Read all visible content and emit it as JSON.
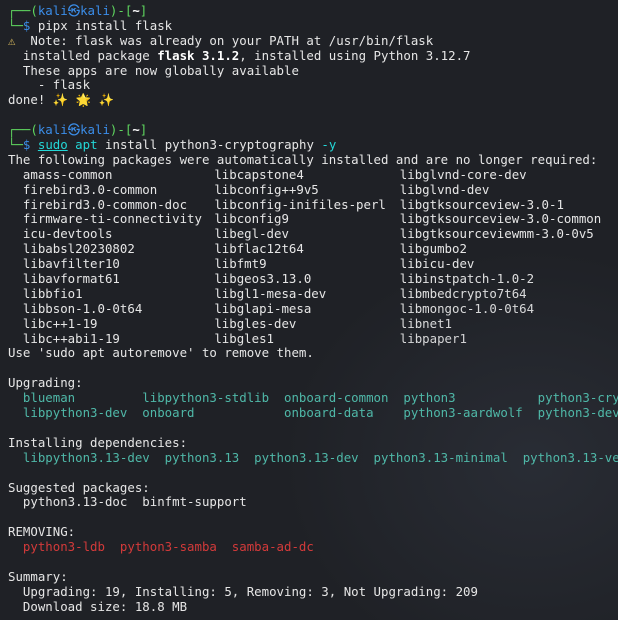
{
  "prompt1": {
    "top": "┌──(",
    "user": "kali",
    "at": "㉿",
    "host": "kali",
    "dir_open": ")-[",
    "dir": "~",
    "dir_close": "]",
    "bottom": "└─",
    "dollar": "$",
    "command": "pipx install flask"
  },
  "pipx_output": {
    "warn_symbol": "⚠",
    "note": "  Note: flask was already on your PATH at /usr/bin/flask",
    "installed_pre": "  installed package ",
    "installed_pkg": "flask 3.1.2",
    "installed_post": ", installed using Python 3.12.7",
    "apps_line": "  These apps are now globally available",
    "app_item": "    - flask",
    "done": "done! ✨ 🌟 ✨"
  },
  "prompt2": {
    "top": "┌──(",
    "user": "kali",
    "at": "㉿",
    "host": "kali",
    "dir_open": ")-[",
    "dir": "~",
    "dir_close": "]",
    "bottom": "└─",
    "dollar": "$",
    "cmd_sudo": "sudo",
    "cmd_apt": "apt",
    "cmd_rest": "install python3-cryptography",
    "cmd_flag": "-y"
  },
  "apt_output": {
    "auto_installed_header": "The following packages were automatically installed and are no longer required:",
    "auto_installed": [
      [
        "  amass-common",
        "libcapstone4",
        "libglvnd-core-dev"
      ],
      [
        "  firebird3.0-common",
        "libconfig++9v5",
        "libglvnd-dev"
      ],
      [
        "  firebird3.0-common-doc",
        "libconfig-inifiles-perl",
        "libgtksourceview-3.0-1"
      ],
      [
        "  firmware-ti-connectivity",
        "libconfig9",
        "libgtksourceview-3.0-common"
      ],
      [
        "  icu-devtools",
        "libegl-dev",
        "libgtksourceviewmm-3.0-0v5"
      ],
      [
        "  libabsl20230802",
        "libflac12t64",
        "libgumbo2"
      ],
      [
        "  libavfilter10",
        "libfmt9",
        "libicu-dev"
      ],
      [
        "  libavformat61",
        "libgeos3.13.0",
        "libinstpatch-1.0-2"
      ],
      [
        "  libbfio1",
        "libgl1-mesa-dev",
        "libmbedcrypto7t64"
      ],
      [
        "  libbson-1.0-0t64",
        "libglapi-mesa",
        "libmongoc-1.0-0t64"
      ],
      [
        "  libc++1-19",
        "libgles-dev",
        "libnet1"
      ],
      [
        "  libc++abi1-19",
        "libgles1",
        "libpaper1"
      ]
    ],
    "autoremove": "Use 'sudo apt autoremove' to remove them.",
    "upgrading_header": "Upgrading:",
    "upgrading_line1": "  blueman         libpython3-stdlib  onboard-common  python3           python3-cry",
    "upgrading_line2": "  libpython3-dev  onboard            onboard-data    python3-aardwolf  python3-dev",
    "deps_header": "Installing dependencies:",
    "deps_line": "  libpython3.13-dev  python3.13  python3.13-dev  python3.13-minimal  python3.13-ve",
    "suggested_header": "Suggested packages:",
    "suggested_line": "  python3.13-doc  binfmt-support",
    "removing_header": "REMOVING:",
    "removing_line": "  python3-ldb  python3-samba  samba-ad-dc",
    "summary_header": "Summary:",
    "summary_line1": "  Upgrading: 19, Installing: 5, Removing: 3, Not Upgrading: 209",
    "summary_line2": "  Download size: 18.8 MB"
  }
}
